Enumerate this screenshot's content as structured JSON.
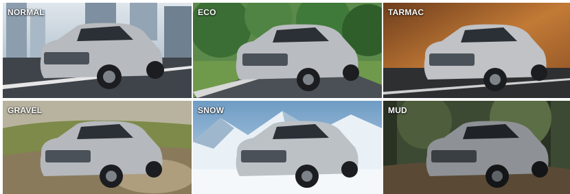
{
  "drive_modes": [
    {
      "label": "NORMAL"
    },
    {
      "label": "ECO"
    },
    {
      "label": "TARMAC"
    },
    {
      "label": "GRAVEL"
    },
    {
      "label": "SNOW"
    },
    {
      "label": "MUD"
    }
  ],
  "colors": {
    "label_text": "#ffffff",
    "vehicle_body": "#b9bcc0",
    "normal_sky": "#cfd8e0",
    "eco_foliage": "#3f7a3a",
    "tarmac_sand": "#b06a2e",
    "gravel_earth": "#8a7a5c",
    "snow_sky": "#8fb8d8",
    "mud_forest": "#3d4a33"
  }
}
